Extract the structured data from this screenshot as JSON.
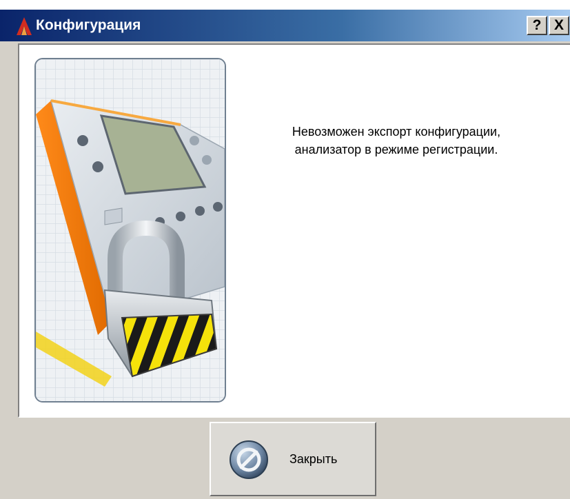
{
  "window": {
    "title": "Конфигурация",
    "help_button": "?",
    "close_button": "X",
    "app_icon": "app-logo-icon"
  },
  "dialog": {
    "message_line1": "Невозможен экспорт конфигурации,",
    "message_line2": "анализатор в режиме регистрации.",
    "illustration": "locked-analyzer-illustration"
  },
  "footer": {
    "close_label": "Закрыть",
    "close_icon": "cancel-icon"
  },
  "colors": {
    "titlebar_start": "#0a246a",
    "titlebar_end": "#a6caf0",
    "window_bg": "#d4d0c8",
    "content_bg": "#ffffff"
  }
}
